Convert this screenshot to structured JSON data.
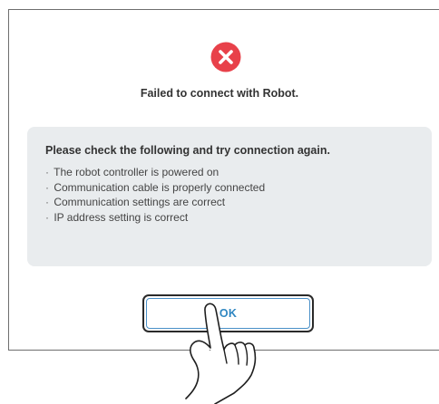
{
  "dialog": {
    "icon": "error-x-circle-icon",
    "error_color": "#e8414a",
    "title": "Failed to connect with Robot.",
    "info": {
      "heading": "Please check the following and try connection again.",
      "bullet": "·",
      "items": [
        "The robot controller is powered on",
        "Communication cable is properly connected",
        "Communication settings are correct",
        "IP address setting is correct"
      ]
    },
    "ok_label": "OK",
    "accent_color": "#2e86c1"
  },
  "overlay": {
    "icon": "pointing-hand-icon"
  }
}
